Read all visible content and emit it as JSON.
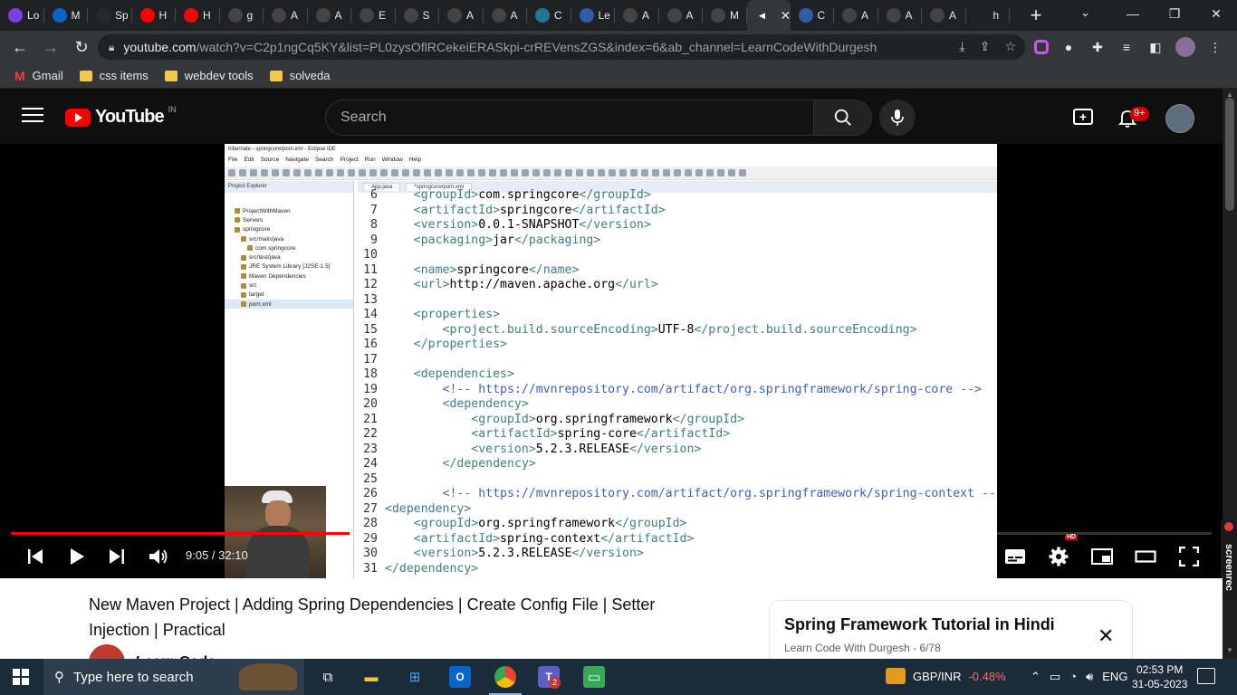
{
  "browser": {
    "tabs": [
      {
        "label": "Lo",
        "icon": "university-icon",
        "color": "#7b3fe4"
      },
      {
        "label": "M",
        "icon": "outlook-icon",
        "color": "#0a64c9"
      },
      {
        "label": "Sp",
        "icon": "github-icon",
        "color": "#24292e"
      },
      {
        "label": "H",
        "icon": "youtube-icon",
        "color": "#ff0000"
      },
      {
        "label": "H",
        "icon": "youtube-icon",
        "color": "#ff0000"
      },
      {
        "label": "g",
        "icon": "openai-icon",
        "color": "#444444"
      },
      {
        "label": "A",
        "icon": "openai-icon",
        "color": "#444444"
      },
      {
        "label": "A",
        "icon": "openai-icon",
        "color": "#444444"
      },
      {
        "label": "E",
        "icon": "openai-icon",
        "color": "#444444"
      },
      {
        "label": "S",
        "icon": "openai-icon",
        "color": "#444444"
      },
      {
        "label": "A",
        "icon": "openai-icon",
        "color": "#444444"
      },
      {
        "label": "A",
        "icon": "openai-icon",
        "color": "#444444"
      },
      {
        "label": "C",
        "icon": "wordpress-icon",
        "color": "#21759b"
      },
      {
        "label": "Le",
        "icon": "diamond-icon",
        "color": "#2f5da8"
      },
      {
        "label": "A",
        "icon": "openai-icon",
        "color": "#444444"
      },
      {
        "label": "A",
        "icon": "openai-icon",
        "color": "#444444"
      },
      {
        "label": "M",
        "icon": "openai-icon",
        "color": "#444444"
      },
      {
        "label": "",
        "icon": "speaker-icon",
        "color": "#35363a",
        "active": true
      },
      {
        "label": "C",
        "icon": "diamond-icon",
        "color": "#2f5da8"
      },
      {
        "label": "A",
        "icon": "openai-icon",
        "color": "#444444"
      },
      {
        "label": "A",
        "icon": "openai-icon",
        "color": "#444444"
      },
      {
        "label": "A",
        "icon": "openai-icon",
        "color": "#444444"
      },
      {
        "label": "h",
        "icon": "",
        "color": "#202124"
      }
    ],
    "new_tab": "+",
    "url_host": "youtube.com",
    "url_path": "/watch?v=C2p1ngCq5KY&list=PL0zysOflRCekeiERASkpi-crREVensZGS&index=6&ab_channel=LearnCodeWithDurgesh",
    "bookmarks": [
      {
        "label": "Gmail",
        "icon": "gmail-icon"
      },
      {
        "label": "css items",
        "icon": "folder-icon"
      },
      {
        "label": "webdev tools",
        "icon": "folder-icon"
      },
      {
        "label": "solveda",
        "icon": "folder-icon"
      }
    ]
  },
  "youtube": {
    "logo_text": "YouTube",
    "region": "IN",
    "search_placeholder": "Search",
    "notification_badge": "9+",
    "accent": "#ff0000"
  },
  "video": {
    "ide": {
      "window_title": "hibernate - springcore/pom.xml - Eclipse IDE",
      "menu": [
        "File",
        "Edit",
        "Source",
        "Navigate",
        "Search",
        "Project",
        "Run",
        "Window",
        "Help"
      ],
      "explorer_title": "Project Explorer",
      "tree": [
        {
          "label": "ProjectWithMaven",
          "indent": 1
        },
        {
          "label": "Servers",
          "indent": 1
        },
        {
          "label": "springcore",
          "indent": 1
        },
        {
          "label": "src/main/java",
          "indent": 2
        },
        {
          "label": "com.springcore",
          "indent": 3
        },
        {
          "label": "src/test/java",
          "indent": 2
        },
        {
          "label": "JRE System Library [J2SE-1.5]",
          "indent": 2
        },
        {
          "label": "Maven Dependencies",
          "indent": 2
        },
        {
          "label": "src",
          "indent": 2
        },
        {
          "label": "target",
          "indent": 2
        },
        {
          "label": "pom.xml",
          "indent": 2,
          "selected": true
        }
      ],
      "editor_tabs": [
        "App.java",
        "*springcore/pom.xml"
      ],
      "code_lines": [
        {
          "n": "6",
          "t": "    <groupId>com.springcore</groupId>"
        },
        {
          "n": "7",
          "t": "    <artifactId>springcore</artifactId>"
        },
        {
          "n": "8",
          "t": "    <version>0.0.1-SNAPSHOT</version>"
        },
        {
          "n": "9",
          "t": "    <packaging>jar</packaging>"
        },
        {
          "n": "10",
          "t": ""
        },
        {
          "n": "11",
          "t": "    <name>springcore</name>"
        },
        {
          "n": "12",
          "t": "    <url>http://maven.apache.org</url>"
        },
        {
          "n": "13",
          "t": ""
        },
        {
          "n": "14",
          "t": "    <properties>"
        },
        {
          "n": "15",
          "t": "        <project.build.sourceEncoding>UTF-8</project.build.sourceEncoding>"
        },
        {
          "n": "16",
          "t": "    </properties>"
        },
        {
          "n": "17",
          "t": ""
        },
        {
          "n": "18",
          "t": "    <dependencies>"
        },
        {
          "n": "19",
          "t": "        <!-- https://mvnrepository.com/artifact/org.springframework/spring-core -->"
        },
        {
          "n": "20",
          "t": "        <dependency>"
        },
        {
          "n": "21",
          "t": "            <groupId>org.springframework</groupId>"
        },
        {
          "n": "22",
          "t": "            <artifactId>spring-core</artifactId>"
        },
        {
          "n": "23",
          "t": "            <version>5.2.3.RELEASE</version>"
        },
        {
          "n": "24",
          "t": "        </dependency>"
        },
        {
          "n": "25",
          "t": ""
        },
        {
          "n": "26",
          "t": "        <!-- https://mvnrepository.com/artifact/org.springframework/spring-context --"
        },
        {
          "n": "27",
          "t": "<dependency>"
        },
        {
          "n": "28",
          "t": "    <groupId>org.springframework</groupId>"
        },
        {
          "n": "29",
          "t": "    <artifactId>spring-context</artifactId>"
        },
        {
          "n": "30",
          "t": "    <version>5.2.3.RELEASE</version>"
        },
        {
          "n": "31",
          "t": "</dependency>"
        }
      ]
    },
    "time_display": "9:05 / 32:10",
    "progress_fraction": 0.2822,
    "hd_badge": "HD",
    "recorder_label": "screenrec",
    "title": "New Maven Project | Adding Spring Dependencies | Create Config File | Setter Injection | Practical",
    "channel": "Learn Code"
  },
  "playlist": {
    "title": "Spring Framework Tutorial in Hindi",
    "subtitle": "Learn Code With Durgesh - 6/78",
    "close": "✕"
  },
  "taskbar": {
    "search_placeholder": "Type here to search",
    "ticker_pair": "GBP/INR",
    "ticker_change": "-0.48%",
    "language": "ENG",
    "time": "02:53 PM",
    "date": "31-05-2023",
    "teams_badge": "2"
  }
}
